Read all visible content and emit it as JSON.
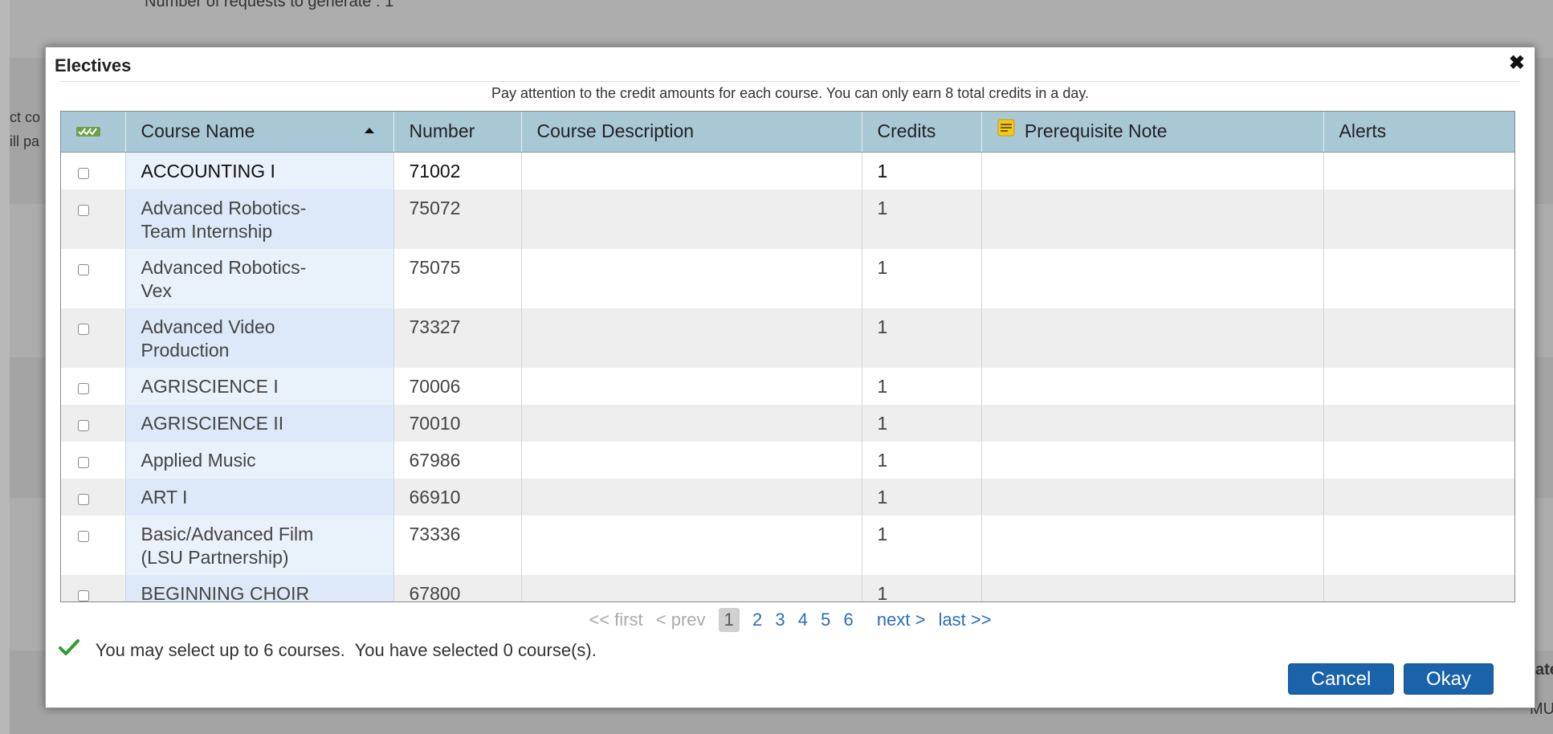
{
  "background": {
    "top_text": "Number of requests to generate : 1",
    "left_text_1": "ct co",
    "left_text_2": "ill pa",
    "right_text_1": "ate",
    "right_text_2": "MU"
  },
  "dialog": {
    "title": "Electives",
    "close_glyph": "✖",
    "notice": "Pay attention to the credit amounts for each course. You can only earn 8 total credits in a day."
  },
  "table": {
    "columns": {
      "name": "Course Name",
      "number": "Number",
      "description": "Course Description",
      "credits": "Credits",
      "prereq": "Prerequisite Note",
      "alerts": "Alerts"
    },
    "rows": [
      {
        "name": "ACCOUNTING I",
        "number": "71002",
        "description": "",
        "credits": "1",
        "prereq": "",
        "alerts": ""
      },
      {
        "name": "Advanced Robotics-\nTeam Internship",
        "number": "75072",
        "description": "",
        "credits": "1",
        "prereq": "",
        "alerts": ""
      },
      {
        "name": "Advanced Robotics-\nVex",
        "number": "75075",
        "description": "",
        "credits": "1",
        "prereq": "",
        "alerts": ""
      },
      {
        "name": "Advanced Video\nProduction",
        "number": "73327",
        "description": "",
        "credits": "1",
        "prereq": "",
        "alerts": ""
      },
      {
        "name": "AGRISCIENCE I",
        "number": "70006",
        "description": "",
        "credits": "1",
        "prereq": "",
        "alerts": ""
      },
      {
        "name": "AGRISCIENCE II",
        "number": "70010",
        "description": "",
        "credits": "1",
        "prereq": "",
        "alerts": ""
      },
      {
        "name": "Applied Music",
        "number": "67986",
        "description": "",
        "credits": "1",
        "prereq": "",
        "alerts": ""
      },
      {
        "name": "ART I",
        "number": "66910",
        "description": "",
        "credits": "1",
        "prereq": "",
        "alerts": ""
      },
      {
        "name": "Basic/Advanced Film\n(LSU Partnership)",
        "number": "73336",
        "description": "",
        "credits": "1",
        "prereq": "",
        "alerts": ""
      },
      {
        "name": "BEGINNING CHOIR",
        "number": "67800",
        "description": "",
        "credits": "1",
        "prereq": "",
        "alerts": ""
      }
    ]
  },
  "pager": {
    "first": "<< first",
    "prev": "< prev",
    "current": "1",
    "pages": [
      "2",
      "3",
      "4",
      "5",
      "6"
    ],
    "next": "next >",
    "last": "last >>"
  },
  "status": "You may select up to 6 courses.  You have selected 0 course(s).",
  "buttons": {
    "cancel": "Cancel",
    "okay": "Okay"
  },
  "colors": {
    "header_bg": "#a9c8d6",
    "name_col_bg": "#e9f1fb",
    "button_blue": "#1a62a9",
    "link_blue": "#2a6ebb",
    "check_green": "#2f9a2f"
  }
}
